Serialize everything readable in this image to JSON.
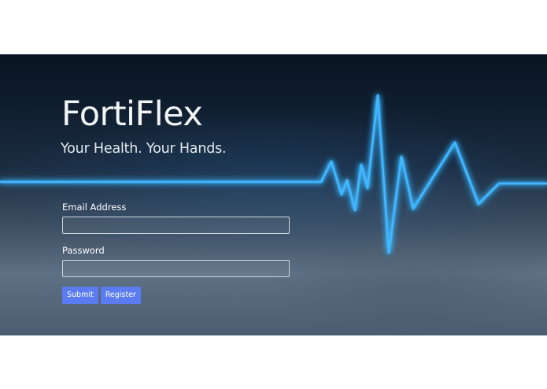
{
  "hero": {
    "title": "FortiFlex",
    "tagline": "Your Health. Your Hands."
  },
  "login": {
    "email_label": "Email Address",
    "email_value": "",
    "email_placeholder": "",
    "password_label": "Password",
    "password_value": "",
    "password_placeholder": "",
    "submit_label": "Submit",
    "register_label": "Register"
  },
  "colors": {
    "button": "#5a7cf0",
    "heartbeat_line": "#3fb6ff",
    "hero_top": "#0a1422",
    "hero_bottom": "#5e7084"
  },
  "icons": {
    "background_graphic": "heartbeat-ecg-line"
  }
}
